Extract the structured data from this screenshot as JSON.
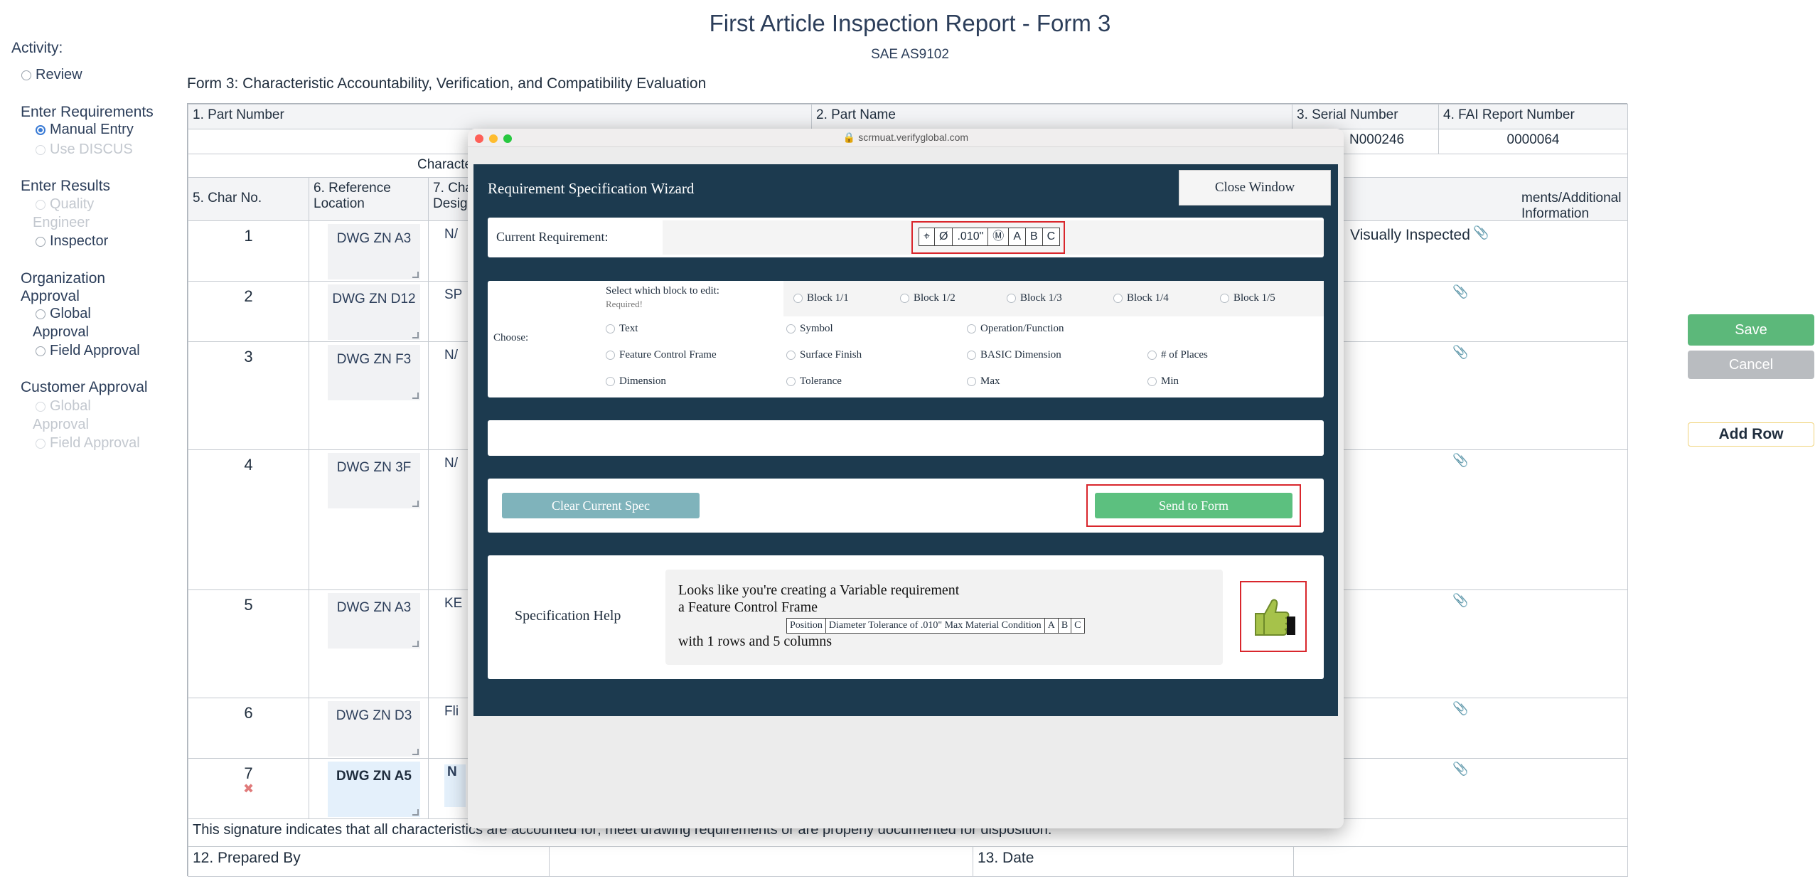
{
  "page": {
    "title": "First Article Inspection Report - Form 3",
    "subtitle": "SAE AS9102",
    "form_description": "Form 3: Characteristic Accountability, Verification, and Compatibility Evaluation"
  },
  "sidebar": {
    "activity_label": "Activity:",
    "review": "Review",
    "enter_requirements": "Enter Requirements",
    "manual_entry": "Manual Entry",
    "use_discus": "Use DISCUS",
    "enter_results": "Enter Results",
    "quality_engineer_1": "Quality",
    "quality_engineer_2": "Engineer",
    "inspector": "Inspector",
    "org_approval_1": "Organization",
    "org_approval_2": "Approval",
    "org_global_1": "Global",
    "org_global_2": "Approval",
    "org_field": "Field Approval",
    "customer_approval": "Customer Approval",
    "cust_global_1": "Global",
    "cust_global_2": "Approval",
    "cust_field": "Field Approval"
  },
  "table": {
    "h_part_number": "1. Part Number",
    "h_part_name": "2. Part Name",
    "h_serial_number": "3. Serial Number",
    "h_fai_report": "4. FAI Report Number",
    "serial_value": "N000246",
    "fai_value": "0000064",
    "h_characteristic": "Characte",
    "h_char_no": "5. Char No.",
    "h_ref_location_1": "6. Reference",
    "h_ref_location_2": "Location",
    "h_char_design_1": "7. Cha",
    "h_char_design_2": "Desig",
    "h_comments": "ments/Additional Information",
    "rows": [
      {
        "no": "1",
        "ref": "DWG ZN A3",
        "design": "N/",
        "comment": "Visually Inspected"
      },
      {
        "no": "2",
        "ref": "DWG ZN D12",
        "design": "SP",
        "comment": ""
      },
      {
        "no": "3",
        "ref": "DWG ZN F3",
        "design": "N/",
        "comment": ""
      },
      {
        "no": "4",
        "ref": "DWG ZN 3F",
        "design": "N/",
        "comment": ""
      },
      {
        "no": "5",
        "ref": "DWG ZN A3",
        "design": "KE",
        "comment": ""
      },
      {
        "no": "6",
        "ref": "DWG ZN D3",
        "design": "Fli",
        "comment": ""
      },
      {
        "no": "7",
        "ref": "DWG ZN A5",
        "design": "N",
        "comment": ""
      }
    ],
    "signature_note": "This signature indicates that all characteristics are accounted for; meet drawing requirements or are properly documented for disposition.",
    "prepared_by": "12. Prepared By",
    "date": "13. Date"
  },
  "actions": {
    "save": "Save",
    "cancel": "Cancel",
    "add_row": "Add Row"
  },
  "modal": {
    "url": "scrmuat.verifyglobal.com",
    "title": "Requirement Specification Wizard",
    "close": "Close Window",
    "current_requirement_label": "Current Requirement:",
    "current_fcf": [
      "⌖",
      "Ø",
      ".010\"",
      "Ⓜ",
      "A",
      "B",
      "C"
    ],
    "choose_label": "Choose:",
    "select_block_label": "Select which block to edit:",
    "required": "Required!",
    "blocks": [
      "Block 1/1",
      "Block 1/2",
      "Block 1/3",
      "Block 1/4",
      "Block 1/5"
    ],
    "options": [
      [
        "Text",
        "Symbol",
        "Operation/Function",
        ""
      ],
      [
        "Feature Control Frame",
        "Surface Finish",
        "BASIC Dimension",
        "# of Places"
      ],
      [
        "Dimension",
        "Tolerance",
        "Max",
        "Min"
      ]
    ],
    "clear": "Clear Current Spec",
    "send": "Send to Form",
    "help_label": "Specification Help",
    "help_line1": "Looks like you're creating a Variable requirement",
    "help_line2": "a Feature Control Frame",
    "help_fcf": [
      "Position",
      "Diameter Tolerance of .010\" Max Material Condition",
      "A",
      "B",
      "C"
    ],
    "help_line3": "with 1 rows and 5 columns"
  },
  "colors": {
    "wizard_bg": "#1c3a4f",
    "save": "#5cb87a",
    "send": "#5cc07f",
    "clear": "#7fb3bb",
    "highlight": "#d9262c",
    "title": "#2c3e5a"
  }
}
